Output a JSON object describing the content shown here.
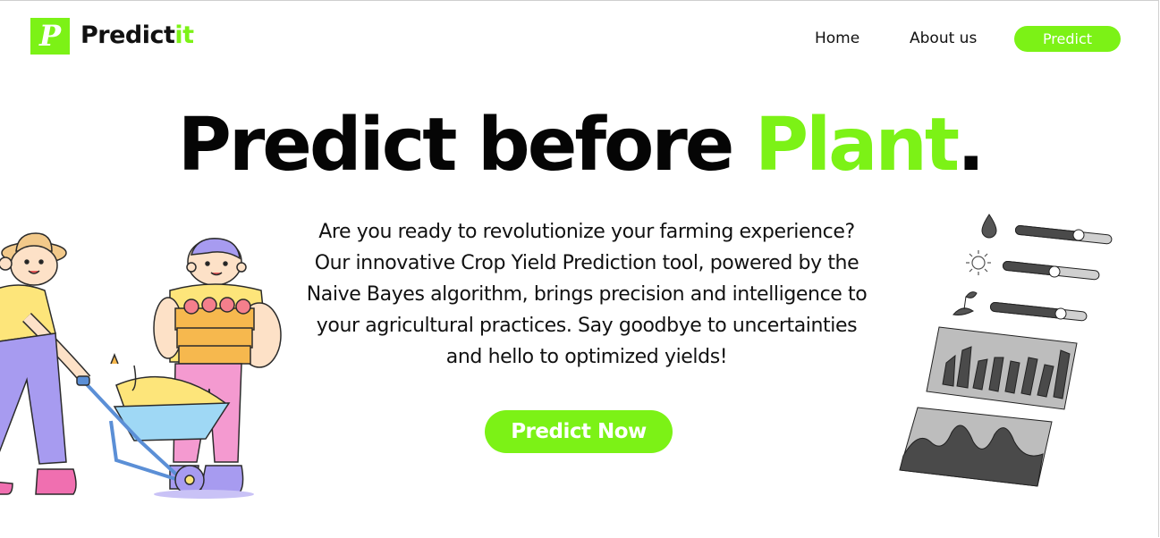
{
  "header": {
    "logo_letter": "P",
    "brand_main": "Predict",
    "brand_accent": "it",
    "nav": {
      "home": "Home",
      "about": "About us",
      "predict": "Predict"
    }
  },
  "hero": {
    "headline_main": "Predict before ",
    "headline_accent": "Plant",
    "headline_end": ".",
    "tagline_lines": [
      "Are you ready to revolutionize your farming experience?",
      "Our innovative Crop Yield Prediction tool, powered by the",
      "Naive Bayes algorithm, brings precision and intelligence to",
      "your agricultural practices. Say goodbye to uncertainties",
      "and hello to optimized yields!"
    ],
    "cta": "Predict Now"
  },
  "illustrations": {
    "left": "farmers-with-wheelbarrow-illustration",
    "right": "crop-data-dashboard-illustration"
  },
  "colors": {
    "accent": "#7cf216",
    "text": "#050505",
    "background": "#ffffff",
    "illustration_gray": "#4a4a4a"
  }
}
